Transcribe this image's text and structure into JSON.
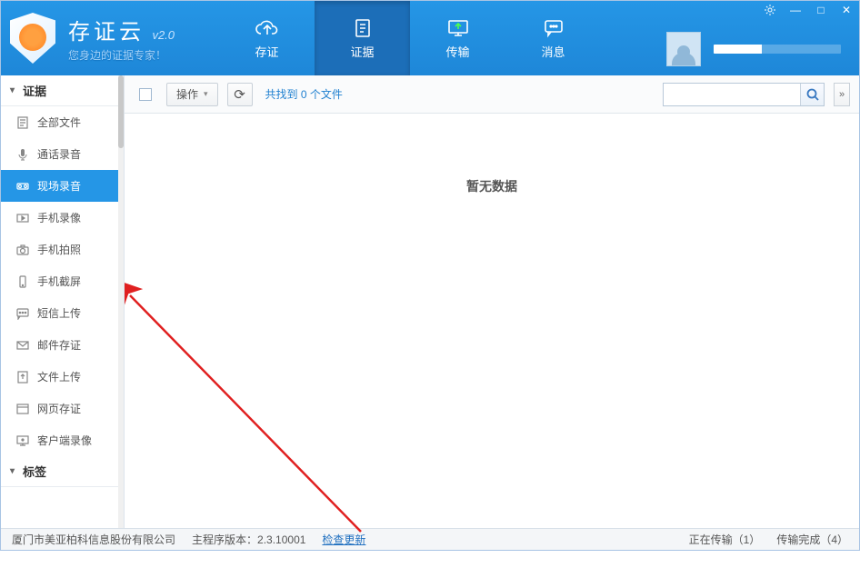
{
  "app": {
    "title": "存证云",
    "version": "v2.0",
    "slogan": "您身边的证据专家！"
  },
  "nav": {
    "tabs": [
      {
        "label": "存证",
        "icon": "cloud-upload"
      },
      {
        "label": "证据",
        "icon": "document"
      },
      {
        "label": "传输",
        "icon": "transfer"
      },
      {
        "label": "消息",
        "icon": "chat"
      }
    ],
    "active_index": 1
  },
  "sidebar": {
    "section1": {
      "title": "证据"
    },
    "items": [
      {
        "label": "全部文件",
        "icon": "file"
      },
      {
        "label": "通话录音",
        "icon": "mic"
      },
      {
        "label": "现场录音",
        "icon": "recorder"
      },
      {
        "label": "手机录像",
        "icon": "video"
      },
      {
        "label": "手机拍照",
        "icon": "camera"
      },
      {
        "label": "手机截屏",
        "icon": "phone"
      },
      {
        "label": "短信上传",
        "icon": "sms"
      },
      {
        "label": "邮件存证",
        "icon": "mail"
      },
      {
        "label": "文件上传",
        "icon": "upload"
      },
      {
        "label": "网页存证",
        "icon": "web"
      },
      {
        "label": "客户端录像",
        "icon": "monitor"
      }
    ],
    "active_index": 2,
    "section2": {
      "title": "标签"
    }
  },
  "toolbar": {
    "operate_label": "操作",
    "count_text": "共找到 0 个文件",
    "search_placeholder": ""
  },
  "content": {
    "empty_text": "暂无数据"
  },
  "statusbar": {
    "company": "厦门市美亚柏科信息股份有限公司",
    "version_label": "主程序版本：",
    "version_value": "2.3.10001",
    "update_link": "检查更新",
    "transferring": "正在传输（1）",
    "completed": "传输完成（4）"
  }
}
